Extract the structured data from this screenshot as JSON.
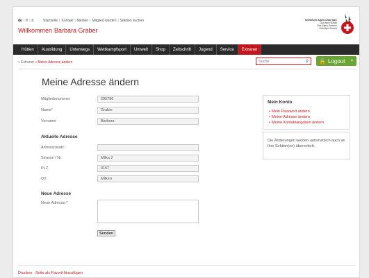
{
  "top": {
    "langs": [
      "de",
      "fr",
      "it"
    ],
    "links": [
      "Startseite",
      "Kontakt",
      "Medien",
      "Mitglied werden",
      "Sektion suchen"
    ],
    "welcome_prefix": "Willkommen",
    "welcome_name": "Barbara Graber"
  },
  "logo": {
    "line1": "Schweizer Alpen-Club SAC",
    "line2": "Club Alpin Suisse",
    "line3": "Club Alpino Svizzero",
    "line4": "Club Alpin Svizzer"
  },
  "nav": [
    "Hütten",
    "Ausbildung",
    "Unterwegs",
    "Wettkampfsport",
    "Umwelt",
    "Shop",
    "Zeitschrift",
    "Jugend",
    "Service",
    "Extranet"
  ],
  "nav_active": "Extranet",
  "breadcrumb": {
    "root": "» Extranet",
    "current": "» Meine Adresse ändern"
  },
  "search": {
    "placeholder": "Suche"
  },
  "logout": {
    "label": "Logout"
  },
  "form": {
    "title": "Meine Adresse ändern",
    "member_number_label": "Mitgliedsnummer",
    "member_number": "295786",
    "name_label": "Name*",
    "name": "Graber",
    "firstname_label": "Vorname",
    "firstname": "Barbara",
    "current_heading": "Aktuelle Adresse",
    "addr_extra_label": "Adresszusatz",
    "addr_extra": "",
    "street_label": "Strasse / Nr.",
    "street": "Milka 2",
    "zip_label": "PLZ",
    "zip": "3157",
    "city_label": "Ort",
    "city": "Milken",
    "new_heading": "Neue Adresse",
    "new_label": "Neue Adresse:*",
    "submit": "Senden"
  },
  "sidebar": {
    "account_title": "Mein Konto",
    "links": [
      "Mein Passwort ändern",
      "Meine Adresse ändern",
      "Meine Kontaktangaben ändern"
    ],
    "info": "Die Änderungen werden automatisch auch an Ihre Sektion(en) übermittelt."
  },
  "footer": {
    "print": "Drucken",
    "favorite": "Seite als Favorit hinzufügen"
  },
  "colors": {
    "accent": "#c4161c",
    "nav_bg": "#2b2b2b",
    "logout": "#6aa531"
  }
}
